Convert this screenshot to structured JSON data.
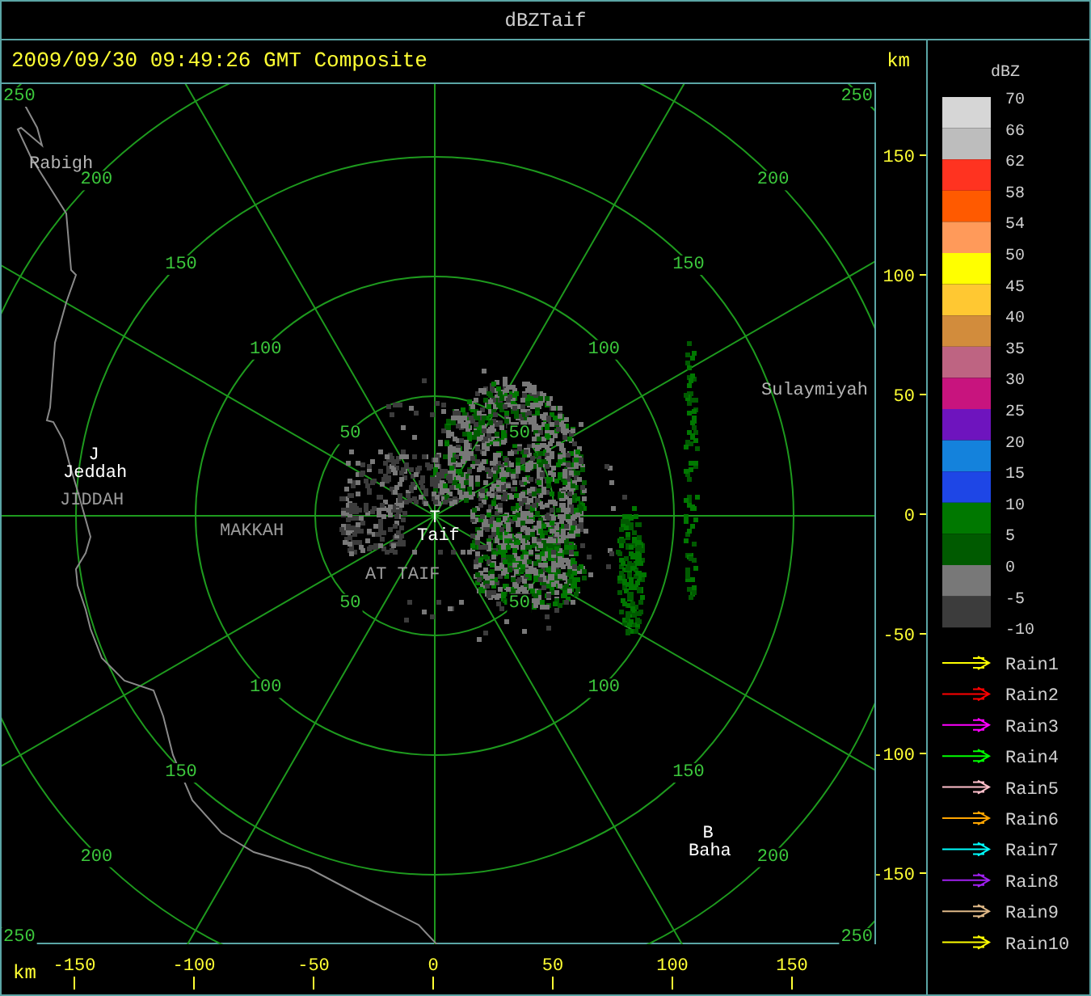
{
  "window": {
    "title": "dBZTaif"
  },
  "header": {
    "timestamp": "2009/09/30 09:49:26 GMT Composite",
    "unit": "km"
  },
  "map": {
    "range_rings": [
      {
        "ne": "50",
        "nw": "50",
        "se": "50",
        "sw": "50"
      },
      {
        "ne": "100",
        "nw": "100",
        "se": "100",
        "sw": "100"
      },
      {
        "ne": "150",
        "nw": "150",
        "se": "150",
        "sw": "150"
      },
      {
        "ne": "200",
        "nw": "200",
        "se": "200",
        "sw": "200"
      },
      {
        "ne": "250",
        "nw": "250",
        "se": "250",
        "sw": "250"
      }
    ],
    "places": [
      {
        "kind": "town",
        "name": "Rabigh"
      },
      {
        "kind": "marker",
        "name": "J"
      },
      {
        "kind": "city",
        "name": "Jeddah"
      },
      {
        "kind": "district",
        "name": "JIDDAH"
      },
      {
        "kind": "district",
        "name": "MAKKAH"
      },
      {
        "kind": "marker",
        "name": "T"
      },
      {
        "kind": "city",
        "name": "Taif"
      },
      {
        "kind": "district",
        "name": "AT TAIF"
      },
      {
        "kind": "town",
        "name": "Sulaymiyah"
      },
      {
        "kind": "marker",
        "name": "B"
      },
      {
        "kind": "city",
        "name": "Baha"
      }
    ]
  },
  "y_axis": {
    "ticks": [
      "150",
      "100",
      "50",
      "0",
      "-50",
      "-100",
      "-150"
    ]
  },
  "x_axis": {
    "unit": "km",
    "ticks": [
      "-150",
      "-100",
      "-50",
      "0",
      "50",
      "100",
      "150"
    ]
  },
  "legend": {
    "title": "dBZ",
    "bins": [
      {
        "color": "#d6d6d6"
      },
      {
        "color": "#bdbdbd"
      },
      {
        "color": "#ff3320"
      },
      {
        "color": "#ff5a00"
      },
      {
        "color": "#ff9a5a"
      },
      {
        "color": "#ffff00"
      },
      {
        "color": "#ffc832"
      },
      {
        "color": "#d28c3c"
      },
      {
        "color": "#be6482"
      },
      {
        "color": "#c8147e"
      },
      {
        "color": "#6e14be"
      },
      {
        "color": "#1482dc"
      },
      {
        "color": "#1e46e6"
      },
      {
        "color": "#007800"
      },
      {
        "color": "#005a00"
      },
      {
        "color": "#787878"
      },
      {
        "color": "#3c3c3c"
      }
    ],
    "labels": [
      "70",
      "66",
      "62",
      "58",
      "54",
      "50",
      "45",
      "40",
      "35",
      "30",
      "25",
      "20",
      "15",
      "10",
      "5",
      "0",
      "-5",
      "-10"
    ]
  },
  "rain_legend": [
    {
      "label": "Rain1",
      "color": "#ffff00"
    },
    {
      "label": "Rain2",
      "color": "#ff0000"
    },
    {
      "label": "Rain3",
      "color": "#ff00ff"
    },
    {
      "label": "Rain4",
      "color": "#00ff00"
    },
    {
      "label": "Rain5",
      "color": "#ffc0cb"
    },
    {
      "label": "Rain6",
      "color": "#ffa500"
    },
    {
      "label": "Rain7",
      "color": "#00ffff"
    },
    {
      "label": "Rain8",
      "color": "#a020f0"
    },
    {
      "label": "Rain9",
      "color": "#deb887"
    },
    {
      "label": "Rain10",
      "color": "#ffff00"
    }
  ]
}
